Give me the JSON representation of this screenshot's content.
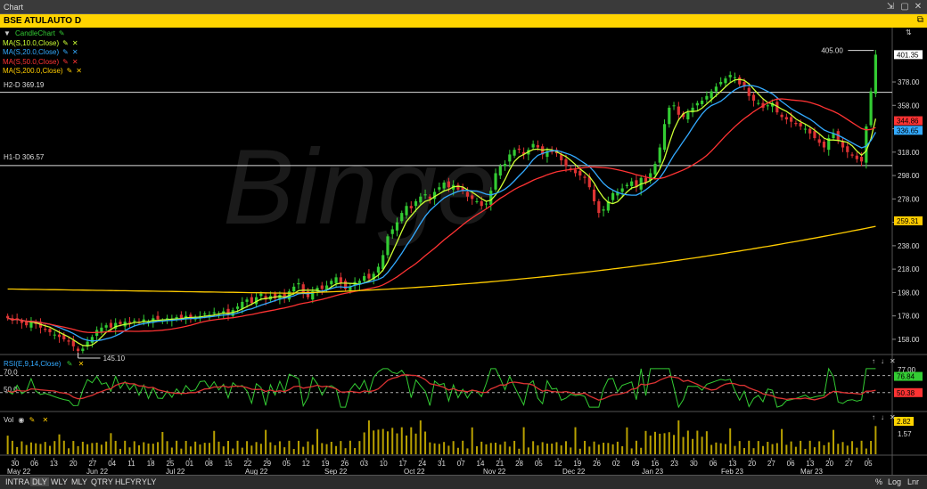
{
  "window": {
    "title": "Chart",
    "controls": {
      "pin": "⇲",
      "maximize": "▢",
      "close": "✕"
    }
  },
  "symbol": {
    "label": "BSE ATULAUTO D"
  },
  "legend": {
    "candle": {
      "label": "CandleChart",
      "color": "#33cc33"
    },
    "ma": [
      {
        "label": "MA(S,10.0,Close)",
        "color": "#ccff33"
      },
      {
        "label": "MA(S,20.0,Close)",
        "color": "#33aaff"
      },
      {
        "label": "MA(S,50.0,Close)",
        "color": "#ff3333"
      },
      {
        "label": "MA(S,200.0,Close)",
        "color": "#ffcc00"
      }
    ]
  },
  "hlines": {
    "h2": {
      "label": "H2-D 369.19",
      "value": 369.19
    },
    "h1": {
      "label": "H1-D 306.57",
      "value": 306.57
    }
  },
  "annotations": {
    "high": "405.00",
    "low": "145.10"
  },
  "price_axis": {
    "ticks": [
      "378.00",
      "358.00",
      "338.00",
      "318.00",
      "298.00",
      "278.00",
      "258.00",
      "238.00",
      "218.00",
      "198.00",
      "178.00",
      "158.00"
    ],
    "badges": [
      {
        "label": "401.35",
        "value": 401.35,
        "bg": "#ffffff",
        "fg": "#000000"
      },
      {
        "label": "344.86",
        "value": 344.86,
        "bg": "#ff3333",
        "fg": "#000000"
      },
      {
        "label": "336.65",
        "value": 336.65,
        "bg": "#33aaff",
        "fg": "#000000"
      },
      {
        "label": "259.31",
        "value": 259.31,
        "bg": "#ffcc00",
        "fg": "#000000"
      }
    ]
  },
  "rsi": {
    "label": "RSI(E,9,14,Close)",
    "levels": [
      {
        "label": "70.0",
        "value": 70
      },
      {
        "label": "50.0",
        "value": 50
      }
    ],
    "axis_label": "77.00",
    "badges": [
      {
        "label": "76.84",
        "bg": "#33cc33"
      },
      {
        "label": "50.38",
        "bg": "#ff3333"
      }
    ]
  },
  "volume": {
    "label": "Vol",
    "axis_label": "1.57",
    "badge": {
      "label": "2.82",
      "bg": "#ffd400"
    }
  },
  "date_axis": {
    "ticks": [
      "30",
      "06",
      "13",
      "20",
      "27",
      "04",
      "11",
      "18",
      "25",
      "01",
      "08",
      "15",
      "22",
      "29",
      "05",
      "12",
      "19",
      "26",
      "03",
      "10",
      "17",
      "24",
      "31",
      "07",
      "14",
      "21",
      "28",
      "05",
      "12",
      "19",
      "26",
      "02",
      "09",
      "16",
      "23",
      "30",
      "06",
      "13",
      "20",
      "27",
      "06",
      "13",
      "20",
      "27",
      "05"
    ],
    "months": [
      "May 22",
      "Jun 22",
      "Jul 22",
      "Aug 22",
      "Sep 22",
      "Oct 22",
      "Nov 22",
      "Dec 22",
      "Jan 23",
      "Feb 23",
      "Mar 23"
    ]
  },
  "timeframes": [
    "INTRA",
    "DLY",
    "WLY",
    "MLY",
    "QTRY",
    "HLFYR",
    "YLY"
  ],
  "active_timeframe": "DLY",
  "scale_buttons": [
    "%",
    "Log",
    "Lnr"
  ],
  "watermark": "Binge",
  "chart_data": {
    "type": "candlestick",
    "ylim": [
      145,
      410
    ],
    "series": [
      {
        "name": "MA(S,10.0,Close)",
        "color": "#ccff33"
      },
      {
        "name": "MA(S,20.0,Close)",
        "color": "#33aaff"
      },
      {
        "name": "MA(S,50.0,Close)",
        "color": "#ff3333"
      },
      {
        "name": "MA(S,200.0,Close)",
        "color": "#ffcc00"
      }
    ],
    "closes": [
      176,
      174,
      175,
      172,
      170,
      173,
      171,
      168,
      166,
      164,
      162,
      160,
      158,
      156,
      152,
      148,
      150,
      156,
      160,
      166,
      168,
      170,
      168,
      172,
      171,
      173,
      172,
      174,
      172,
      175,
      173,
      176,
      175,
      174,
      176,
      175,
      177,
      176,
      178,
      177,
      176,
      178,
      180,
      179,
      181,
      180,
      182,
      179,
      183,
      186,
      190,
      192,
      189,
      194,
      197,
      192,
      195,
      193,
      196,
      194,
      199,
      203,
      206,
      198,
      194,
      199,
      202,
      201,
      204,
      208,
      211,
      206,
      201,
      203,
      207,
      208,
      212,
      210,
      214,
      220,
      230,
      246,
      252,
      258,
      266,
      272,
      270,
      276,
      280,
      282,
      278,
      284,
      288,
      292,
      288,
      290,
      286,
      285,
      280,
      278,
      276,
      272,
      274,
      285,
      300,
      306,
      308,
      316,
      320,
      320,
      316,
      320,
      325,
      322,
      316,
      319,
      318,
      317,
      311,
      306,
      303,
      300,
      298,
      296,
      288,
      276,
      266,
      269,
      276,
      283,
      284,
      287,
      290,
      293,
      288,
      296,
      292,
      300,
      308,
      322,
      342,
      356,
      358,
      350,
      348,
      352,
      356,
      360,
      362,
      366,
      370,
      374,
      378,
      381,
      384,
      382,
      376,
      374,
      366,
      362,
      360,
      356,
      358,
      360,
      352,
      348,
      346,
      344,
      342,
      340,
      338,
      334,
      330,
      326,
      322,
      330,
      334,
      328,
      322,
      318,
      315,
      312,
      310,
      340,
      370,
      401.35
    ],
    "rsi": [],
    "volume": []
  }
}
